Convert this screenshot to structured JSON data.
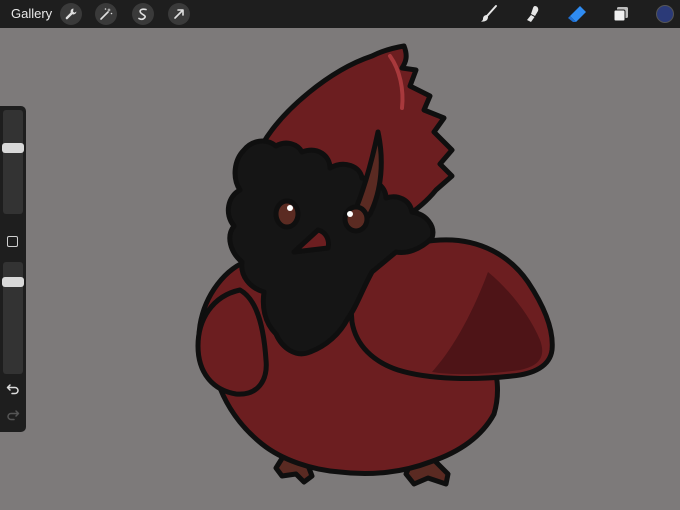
{
  "topbar": {
    "gallery_label": "Gallery",
    "left_tools": [
      "wrench-icon",
      "magic-wand-icon",
      "selection-icon",
      "transform-arrow-icon"
    ],
    "right_tools": [
      "brush-icon",
      "smudge-icon",
      "eraser-icon",
      "layers-icon"
    ],
    "active_tool": "eraser",
    "active_color": "#2b3a78"
  },
  "sidebar": {
    "brush_size": 0.35,
    "opacity": 0.15
  },
  "colors": {
    "canvas_bg": "#7d7a7a",
    "bird_red": "#6c1e20",
    "bird_outline": "#0f0f0f",
    "mask_black": "#151515",
    "accent_blue": "#2f8cf2"
  }
}
